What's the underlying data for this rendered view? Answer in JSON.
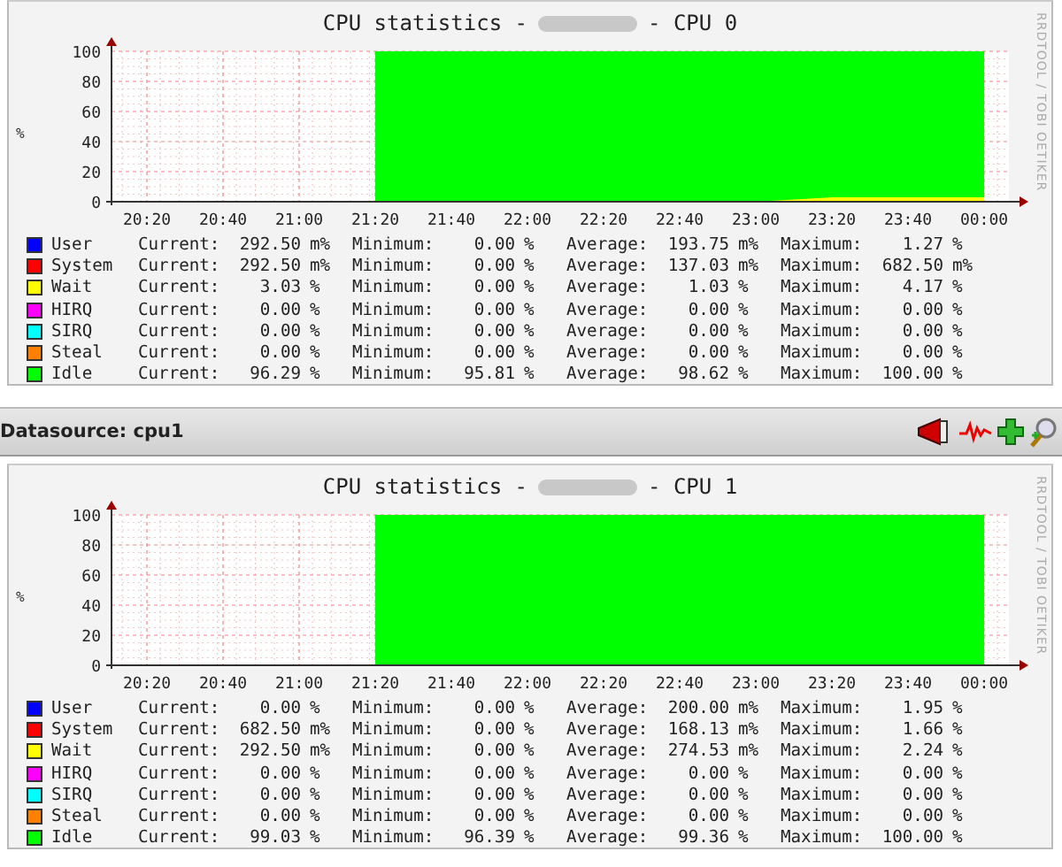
{
  "graphs": [
    {
      "title_prefix": "CPU statistics -",
      "title_suffix": "- CPU 0",
      "side_text": "RRDTOOL / TOBI OETIKER",
      "y_unit": "%",
      "chart_data": {
        "type": "area",
        "grid": true,
        "categories": [
          "20:20",
          "20:40",
          "21:00",
          "21:20",
          "21:40",
          "22:00",
          "22:20",
          "22:40",
          "23:00",
          "23:20",
          "23:40",
          "00:00"
        ],
        "ylim": [
          0,
          100
        ],
        "yticks": [
          0,
          20,
          40,
          60,
          80,
          100
        ],
        "series": [
          {
            "color": "#00ff00",
            "values": [
              null,
              null,
              null,
              100,
              100,
              100,
              100,
              100,
              100,
              100,
              100,
              100
            ]
          },
          {
            "color": "#ffff00",
            "values": [
              null,
              null,
              null,
              0,
              0,
              0,
              0,
              0,
              0,
              3,
              3,
              3
            ]
          }
        ]
      },
      "legend": [
        {
          "name": "User",
          "color": "#0000ff",
          "stats": [
            {
              "label": "Current:",
              "value": "292.50",
              "unit": "m%"
            },
            {
              "label": "Minimum:",
              "value": "0.00",
              "unit": "%"
            },
            {
              "label": "Average:",
              "value": "193.75",
              "unit": "m%"
            },
            {
              "label": "Maximum:",
              "value": "1.27",
              "unit": "%"
            }
          ]
        },
        {
          "name": "System",
          "color": "#ff0000",
          "stats": [
            {
              "label": "Current:",
              "value": "292.50",
              "unit": "m%"
            },
            {
              "label": "Minimum:",
              "value": "0.00",
              "unit": "%"
            },
            {
              "label": "Average:",
              "value": "137.03",
              "unit": "m%"
            },
            {
              "label": "Maximum:",
              "value": "682.50",
              "unit": "m%"
            }
          ]
        },
        {
          "name": "Wait",
          "color": "#ffff00",
          "stats": [
            {
              "label": "Current:",
              "value": "3.03",
              "unit": "%"
            },
            {
              "label": "Minimum:",
              "value": "0.00",
              "unit": "%"
            },
            {
              "label": "Average:",
              "value": "1.03",
              "unit": "%"
            },
            {
              "label": "Maximum:",
              "value": "4.17",
              "unit": "%"
            }
          ]
        },
        {
          "name": "HIRQ",
          "color": "#ff00ff",
          "stats": [
            {
              "label": "Current:",
              "value": "0.00",
              "unit": "%"
            },
            {
              "label": "Minimum:",
              "value": "0.00",
              "unit": "%"
            },
            {
              "label": "Average:",
              "value": "0.00",
              "unit": "%"
            },
            {
              "label": "Maximum:",
              "value": "0.00",
              "unit": "%"
            }
          ]
        },
        {
          "name": "SIRQ",
          "color": "#00ffff",
          "stats": [
            {
              "label": "Current:",
              "value": "0.00",
              "unit": "%"
            },
            {
              "label": "Minimum:",
              "value": "0.00",
              "unit": "%"
            },
            {
              "label": "Average:",
              "value": "0.00",
              "unit": "%"
            },
            {
              "label": "Maximum:",
              "value": "0.00",
              "unit": "%"
            }
          ]
        },
        {
          "name": "Steal",
          "color": "#ff8000",
          "stats": [
            {
              "label": "Current:",
              "value": "0.00",
              "unit": "%"
            },
            {
              "label": "Minimum:",
              "value": "0.00",
              "unit": "%"
            },
            {
              "label": "Average:",
              "value": "0.00",
              "unit": "%"
            },
            {
              "label": "Maximum:",
              "value": "0.00",
              "unit": "%"
            }
          ]
        },
        {
          "name": "Idle",
          "color": "#00ff00",
          "stats": [
            {
              "label": "Current:",
              "value": "96.29",
              "unit": "%"
            },
            {
              "label": "Minimum:",
              "value": "95.81",
              "unit": "%"
            },
            {
              "label": "Average:",
              "value": "98.62",
              "unit": "%"
            },
            {
              "label": "Maximum:",
              "value": "100.00",
              "unit": "%"
            }
          ]
        }
      ]
    },
    {
      "datasource": "Datasource: cpu1",
      "title_prefix": "CPU statistics -",
      "title_suffix": "- CPU 1",
      "side_text": "RRDTOOL / TOBI OETIKER",
      "y_unit": "%",
      "chart_data": {
        "type": "area",
        "grid": true,
        "categories": [
          "20:20",
          "20:40",
          "21:00",
          "21:20",
          "21:40",
          "22:00",
          "22:20",
          "22:40",
          "23:00",
          "23:20",
          "23:40",
          "00:00"
        ],
        "ylim": [
          0,
          100
        ],
        "yticks": [
          0,
          20,
          40,
          60,
          80,
          100
        ],
        "series": [
          {
            "color": "#00ff00",
            "values": [
              null,
              null,
              null,
              100,
              100,
              100,
              100,
              100,
              100,
              100,
              100,
              100
            ]
          }
        ]
      },
      "legend": [
        {
          "name": "User",
          "color": "#0000ff",
          "stats": [
            {
              "label": "Current:",
              "value": "0.00",
              "unit": "%"
            },
            {
              "label": "Minimum:",
              "value": "0.00",
              "unit": "%"
            },
            {
              "label": "Average:",
              "value": "200.00",
              "unit": "m%"
            },
            {
              "label": "Maximum:",
              "value": "1.95",
              "unit": "%"
            }
          ]
        },
        {
          "name": "System",
          "color": "#ff0000",
          "stats": [
            {
              "label": "Current:",
              "value": "682.50",
              "unit": "m%"
            },
            {
              "label": "Minimum:",
              "value": "0.00",
              "unit": "%"
            },
            {
              "label": "Average:",
              "value": "168.13",
              "unit": "m%"
            },
            {
              "label": "Maximum:",
              "value": "1.66",
              "unit": "%"
            }
          ]
        },
        {
          "name": "Wait",
          "color": "#ffff00",
          "stats": [
            {
              "label": "Current:",
              "value": "292.50",
              "unit": "m%"
            },
            {
              "label": "Minimum:",
              "value": "0.00",
              "unit": "%"
            },
            {
              "label": "Average:",
              "value": "274.53",
              "unit": "m%"
            },
            {
              "label": "Maximum:",
              "value": "2.24",
              "unit": "%"
            }
          ]
        },
        {
          "name": "HIRQ",
          "color": "#ff00ff",
          "stats": [
            {
              "label": "Current:",
              "value": "0.00",
              "unit": "%"
            },
            {
              "label": "Minimum:",
              "value": "0.00",
              "unit": "%"
            },
            {
              "label": "Average:",
              "value": "0.00",
              "unit": "%"
            },
            {
              "label": "Maximum:",
              "value": "0.00",
              "unit": "%"
            }
          ]
        },
        {
          "name": "SIRQ",
          "color": "#00ffff",
          "stats": [
            {
              "label": "Current:",
              "value": "0.00",
              "unit": "%"
            },
            {
              "label": "Minimum:",
              "value": "0.00",
              "unit": "%"
            },
            {
              "label": "Average:",
              "value": "0.00",
              "unit": "%"
            },
            {
              "label": "Maximum:",
              "value": "0.00",
              "unit": "%"
            }
          ]
        },
        {
          "name": "Steal",
          "color": "#ff8000",
          "stats": [
            {
              "label": "Current:",
              "value": "0.00",
              "unit": "%"
            },
            {
              "label": "Minimum:",
              "value": "0.00",
              "unit": "%"
            },
            {
              "label": "Average:",
              "value": "0.00",
              "unit": "%"
            },
            {
              "label": "Maximum:",
              "value": "0.00",
              "unit": "%"
            }
          ]
        },
        {
          "name": "Idle",
          "color": "#00ff00",
          "stats": [
            {
              "label": "Current:",
              "value": "99.03",
              "unit": "%"
            },
            {
              "label": "Minimum:",
              "value": "96.39",
              "unit": "%"
            },
            {
              "label": "Average:",
              "value": "99.36",
              "unit": "%"
            },
            {
              "label": "Maximum:",
              "value": "100.00",
              "unit": "%"
            }
          ]
        }
      ]
    }
  ]
}
